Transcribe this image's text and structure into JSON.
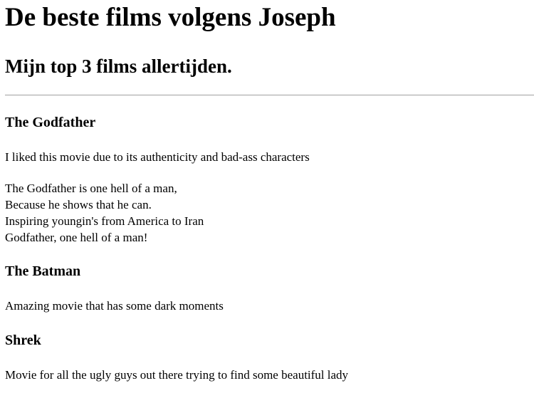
{
  "page": {
    "title": "De beste films volgens Joseph",
    "subtitle": "Mijn top 3 films allertijden."
  },
  "movies": [
    {
      "title": "The Godfather",
      "description": "I liked this movie due to its authenticity and bad-ass characters",
      "poem": [
        "The Godfather is one hell of a man,",
        "Because he shows that he can.",
        "Inspiring youngin's from America to Iran",
        "Godfather, one hell of a man!"
      ]
    },
    {
      "title": "The Batman",
      "description": "Amazing movie that has some dark moments"
    },
    {
      "title": "Shrek",
      "description": "Movie for all the ugly guys out there trying to find some beautiful lady"
    }
  ]
}
